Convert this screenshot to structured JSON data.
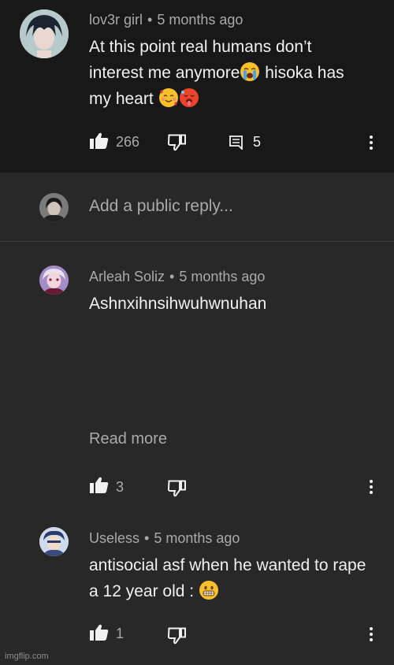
{
  "comment1": {
    "author": "lov3r girl",
    "separator": "•",
    "time": "5 months ago",
    "text_part1": "At this point real humans don’t interest me anymore",
    "text_part2": " hisoka has my heart ",
    "emoji1": "loudly-crying-face",
    "emoji2": "smiling-face-with-hearts",
    "emoji3": "hot-face",
    "likes": "266",
    "replies": "5"
  },
  "reply_bar": {
    "placeholder": "Add a public reply..."
  },
  "comment2": {
    "author": "Arleah Soliz",
    "separator": "•",
    "time": "5 months ago",
    "text": "Ashnxihnsihwuhwnuhan",
    "read_more": "Read more",
    "likes": "3"
  },
  "comment3": {
    "author": "Useless",
    "separator": "•",
    "time": "5 months ago",
    "text": "antisocial asf when he wanted to rape a 12 year old : ",
    "emoji": "grimacing-face",
    "likes": "1"
  },
  "watermark": "imgflip.com",
  "colors": {
    "top_bg": "#181818",
    "page_bg": "#282828",
    "text_primary": "#f1f1f1",
    "text_secondary": "#aaaaaa"
  }
}
